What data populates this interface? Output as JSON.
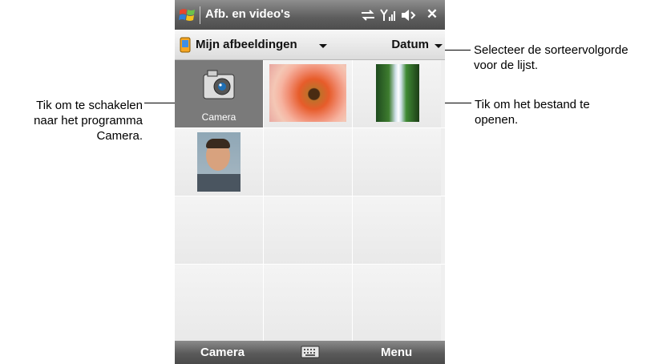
{
  "titlebar": {
    "title": "Afb. en video's",
    "icons": [
      "windows-start-icon",
      "connectivity-icon",
      "signal-icon",
      "volume-icon",
      "close-icon"
    ],
    "close_label": "✕"
  },
  "toolbar": {
    "folder_label": "Mijn afbeeldingen",
    "sort_label": "Datum"
  },
  "grid": {
    "items": [
      {
        "type": "camera",
        "label": "Camera"
      },
      {
        "type": "photo",
        "subject": "flower"
      },
      {
        "type": "photo",
        "subject": "waterfall"
      },
      {
        "type": "photo",
        "subject": "portrait"
      }
    ]
  },
  "softbar": {
    "left_label": "Camera",
    "right_label": "Menu"
  },
  "callouts": {
    "left": "Tik om te schakelen naar het programma Camera.",
    "left_lines": [
      "Tik om te schakelen",
      "naar het programma",
      "Camera."
    ],
    "right_top_lines": [
      "Selecteer de sorteervolgorde",
      "voor de lijst."
    ],
    "right_mid_lines": [
      "Tik om het bestand te",
      "openen."
    ]
  },
  "colors": {
    "titlebar": "#5d5d5d",
    "selected_cell": "#7a7a7a",
    "grid_bg": "#efefef"
  }
}
